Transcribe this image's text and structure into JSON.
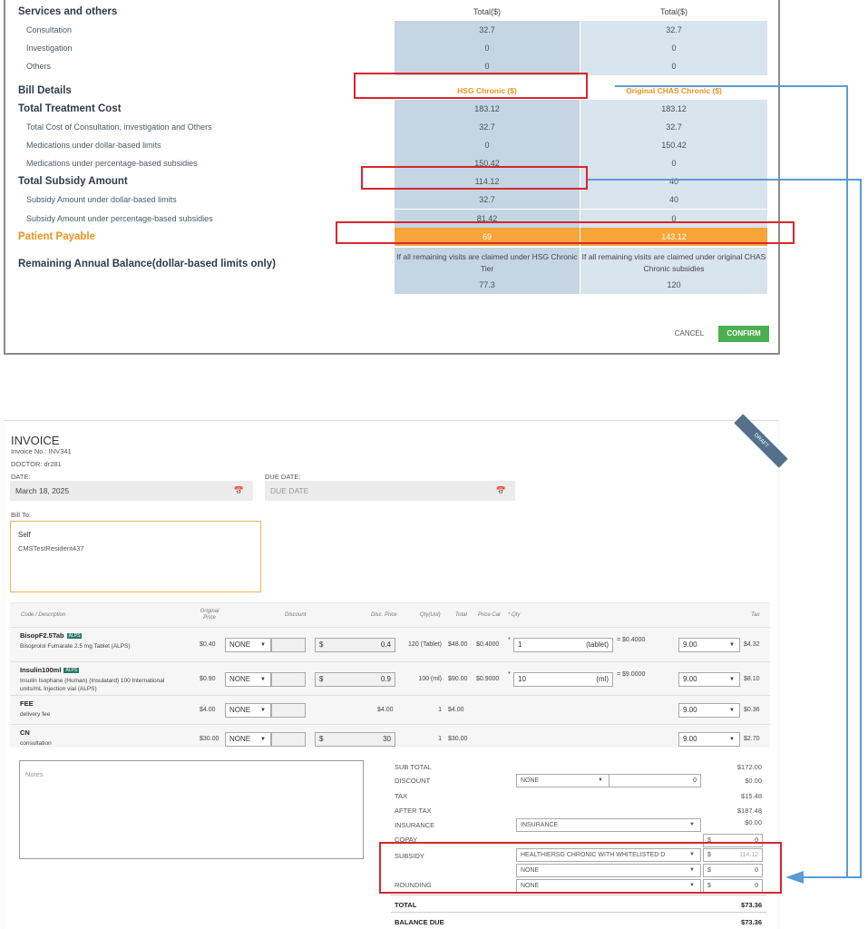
{
  "dialog": {
    "rows": [
      {
        "label": "Services and others",
        "v1": "Total($)",
        "v2": "Total($)",
        "style": "hdr"
      },
      {
        "label": "Consultation",
        "v1": "32.7",
        "v2": "32.7",
        "style": "sub"
      },
      {
        "label": "Investigation",
        "v1": "0",
        "v2": "0",
        "style": "sub"
      },
      {
        "label": "Others",
        "v1": "0",
        "v2": "0",
        "style": "sub"
      },
      {
        "label": "Bill Details",
        "v1": "HSG Chronic ($)",
        "v2": "Original CHAS Chronic ($)",
        "style": "colh"
      },
      {
        "label": "Total Treatment Cost",
        "v1": "183.12",
        "v2": "183.12",
        "style": "h"
      },
      {
        "label": "Total Cost of Consultation, investigation and Others",
        "v1": "32.7",
        "v2": "32.7",
        "style": "sub"
      },
      {
        "label": "Medications under dollar-based limits",
        "v1": "0",
        "v2": "150.42",
        "style": "sub"
      },
      {
        "label": "Medications under percentage-based subsidies",
        "v1": "150.42",
        "v2": "0",
        "style": "sub"
      },
      {
        "label": "Total Subsidy Amount",
        "v1": "114.12",
        "v2": "40",
        "style": "h"
      },
      {
        "label": "Subsidy Amount under dollar-based limits",
        "v1": "32.7",
        "v2": "40",
        "style": "sub"
      },
      {
        "label": "Subsidy Amount under percentage-based subsidies",
        "v1": "81.42",
        "v2": "0",
        "style": "sub"
      },
      {
        "label": "Patient Payable",
        "v1": "69",
        "v2": "143.12",
        "style": "payable"
      }
    ],
    "remaining": {
      "label": "Remaining Annual Balance(dollar-based limits only)",
      "h1": "If all remaining visits are claimed under HSG Chronic Tier",
      "h2": "If all remaining visits are claimed under original CHAS Chronic subsidies",
      "v1": "77.3",
      "v2": "120"
    },
    "cancel": "CANCEL",
    "confirm": "CONFIRM"
  },
  "invoice": {
    "title": "INVOICE",
    "invoice_no": "Invoice No.: INV341",
    "doctor": "DOCTOR:  dr281",
    "ribbon": "DRAFT",
    "date_label": "DATE:",
    "date_value": "March 18, 2025",
    "due_label": "DUE DATE:",
    "due_placeholder": "DUE DATE",
    "bill_to_label": "Bill To:",
    "bill_to_name": "Self",
    "bill_to_resident": "CMSTestResident437",
    "headers": {
      "code": "Code / Description",
      "orig": "Original Price",
      "discount": "Discount",
      "disc_price": "Disc. Price",
      "qty": "Qty(UoI)",
      "total": "Total",
      "price_cal": "Price Cal",
      "pqty": "* Qty",
      "tax": "Tax"
    },
    "items": [
      {
        "code": "BisopF2.5Tab",
        "alps": "ALPS",
        "desc": "Bisoprolol Fumarate 2.5 mg Tablet (ALPS)",
        "orig": "$0.40",
        "discount": "NONE",
        "dollar": "$",
        "disc_price": "0.4",
        "qty": "120 (Tablet)",
        "total": "$48.00",
        "price_cal": "$0.4000",
        "star": "*",
        "qty_input": "1",
        "uom": "(tablet)",
        "eq": "= $0.4000",
        "tax_rate": "9.00",
        "tax": "$4.32"
      },
      {
        "code": "Insulin100ml",
        "alps": "ALPS",
        "desc": "Insulin Isophane (Human) (Insulatard) 100 International units/mL Injection vial (ALPS)",
        "orig": "$0.90",
        "discount": "NONE",
        "dollar": "$",
        "disc_price": "0.9",
        "qty": "100 (ml)",
        "total": "$90.00",
        "price_cal": "$0.9000",
        "star": "*",
        "qty_input": "10",
        "uom": "(ml)",
        "eq": "= $9.0000",
        "tax_rate": "9.00",
        "tax": "$8.10"
      },
      {
        "code": "FEE",
        "desc": "delivery fee",
        "orig": "$4.00",
        "discount": "NONE",
        "disc_price": "$4.00",
        "qty": "1",
        "total": "$4.00",
        "tax_rate": "9.00",
        "tax": "$0.36"
      },
      {
        "code": "CN",
        "desc": "consultation",
        "orig": "$30.00",
        "discount": "NONE",
        "dollar": "$",
        "disc_price": "30",
        "qty": "1",
        "total": "$30.00",
        "tax_rate": "9.00",
        "tax": "$2.70"
      }
    ],
    "notes_placeholder": "Notes",
    "summary": {
      "sub_total_label": "SUB TOTAL",
      "sub_total": "$172.00",
      "discount_label": "DISCOUNT",
      "discount_select": "NONE",
      "discount_input": "0",
      "discount": "$0.00",
      "tax_label": "TAX",
      "tax": "$15.48",
      "after_tax_label": "AFTER TAX",
      "after_tax": "$187.48",
      "insurance_label": "INSURANCE",
      "insurance_select": "INSURANCE",
      "insurance": "$0.00",
      "copay_label": "COPAY",
      "copay_dollar": "$",
      "copay_input": "0",
      "subsidy_label": "SUBSIDY",
      "subsidy_select": "HEALTHIERSG CHRONIC WITH WHITELISTED D",
      "subsidy_dollar": "$",
      "subsidy_input": "114.12",
      "subsidy2_select": "NONE",
      "subsidy2_dollar": "$",
      "subsidy2_input": "0",
      "rounding_label": "ROUNDING",
      "rounding_select": "NONE",
      "rounding_dollar": "$",
      "rounding_input": "0",
      "total_label": "TOTAL",
      "total": "$73.36",
      "balance_label": "BALANCE DUE",
      "balance": "$73.36"
    }
  }
}
